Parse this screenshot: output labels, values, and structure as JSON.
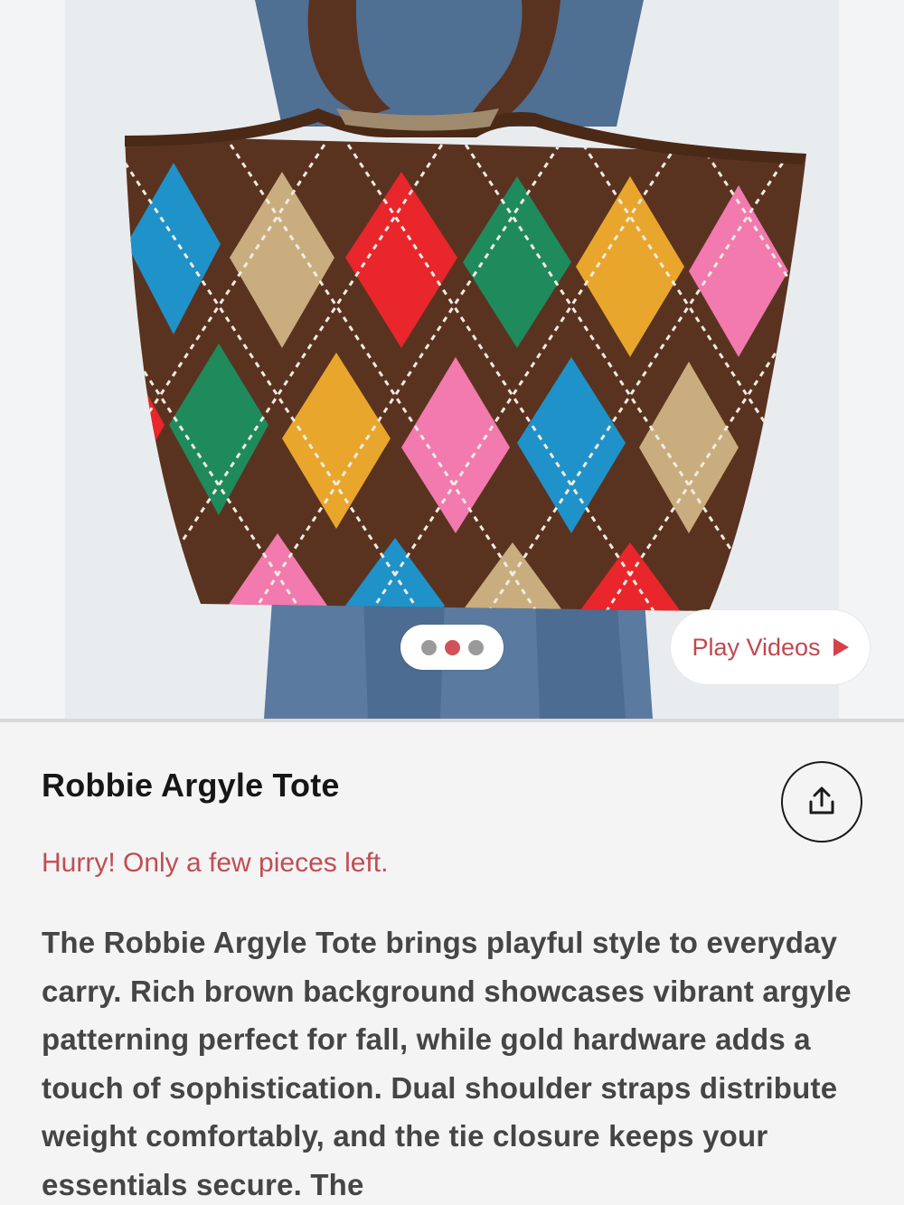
{
  "product": {
    "title": "Robbie Argyle Tote",
    "stock_warning": "Hurry! Only a few pieces left.",
    "description": "The Robbie Argyle Tote brings playful style to everyday carry. Rich brown background showcases vibrant argyle patterning perfect for fall, while gold hardware adds a touch of sophistication. Dual shoulder straps distribute weight comfortably, and the tie closure keeps your essentials secure. The"
  },
  "gallery": {
    "image_count": 3,
    "active_index": 2,
    "play_videos_label": "Play Videos"
  },
  "icons": {
    "share": "share-icon",
    "play": "play-icon"
  },
  "colors": {
    "accent": "#c14d52",
    "dot_active": "#d2525a",
    "dot_inactive": "#9a9a9a",
    "bag_brown": "#5a3320",
    "text_dark": "#161616",
    "text_body": "#454545"
  }
}
